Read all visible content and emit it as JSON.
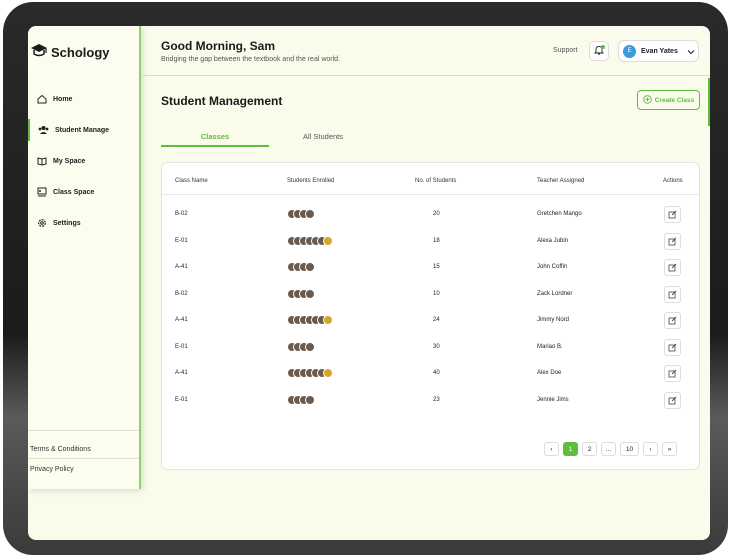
{
  "app": {
    "name": "Schology"
  },
  "sidebar": {
    "items": [
      {
        "label": "Home",
        "icon": "home-icon"
      },
      {
        "label": "Student Manage",
        "icon": "users-icon"
      },
      {
        "label": "My Space",
        "icon": "book-icon"
      },
      {
        "label": "Class Space",
        "icon": "class-icon"
      },
      {
        "label": "Settings",
        "icon": "gear-icon"
      }
    ],
    "active_index": 1,
    "footer": {
      "terms": "Terms & Conditions",
      "privacy": "Privacy Policy"
    }
  },
  "header": {
    "greeting": "Good Morning, Sam",
    "subtitle": "Bridging the gap between the textbook and the real world.",
    "support": "Support",
    "user": {
      "initial": "E",
      "name": "Evan Yates"
    }
  },
  "main": {
    "title": "Student Management",
    "create_button": "Create Class",
    "tabs": [
      {
        "label": "Classes",
        "active": true
      },
      {
        "label": "All Students",
        "active": false
      }
    ]
  },
  "table": {
    "columns": [
      "Class Name",
      "Students Enrolled",
      "No. of Students",
      "Teacher Assigned",
      "Actions"
    ],
    "rows": [
      {
        "class": "B-02",
        "avatars": 4,
        "count": "20",
        "teacher": "Gretchen Mango"
      },
      {
        "class": "E-01",
        "avatars": 7,
        "count": "18",
        "teacher": "Alexa Jubin"
      },
      {
        "class": "A-41",
        "avatars": 4,
        "count": "15",
        "teacher": "John Coffin"
      },
      {
        "class": "B-02",
        "avatars": 4,
        "count": "10",
        "teacher": "Zack Lordner"
      },
      {
        "class": "A-41",
        "avatars": 7,
        "count": "24",
        "teacher": "Jimmy Nord"
      },
      {
        "class": "E-01",
        "avatars": 4,
        "count": "30",
        "teacher": "Mariao B."
      },
      {
        "class": "A-41",
        "avatars": 7,
        "count": "40",
        "teacher": "Alex Doe"
      },
      {
        "class": "E-01",
        "avatars": 4,
        "count": "23",
        "teacher": "Jennie Jims"
      }
    ]
  },
  "pagination": {
    "prev": "‹",
    "pages": [
      "1",
      "2",
      "...",
      "10"
    ],
    "next": "›",
    "last": "»",
    "current": "1"
  },
  "colors": {
    "accent": "#5bbf3b",
    "background": "#fbfbec",
    "user_avatar": "#3a9bd8"
  }
}
